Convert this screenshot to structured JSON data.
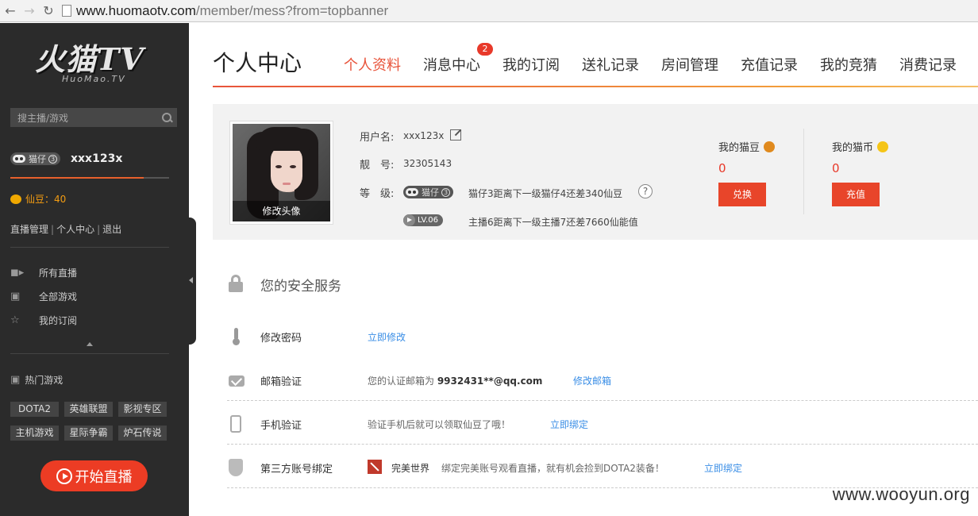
{
  "browser": {
    "url_host": "www.huomaotv.com",
    "url_path": "/member/mess?from=topbanner"
  },
  "sidebar": {
    "logo_main": "火猫TV",
    "logo_sub": "HuoMao.TV",
    "search_placeholder": "搜主播/游戏",
    "user": {
      "badge_label": "猫仔",
      "badge_level": "3",
      "name": "xxx123x",
      "level_progress": 0.84
    },
    "beans": "仙豆：40",
    "user_links": [
      "直播管理",
      "个人中心",
      "退出"
    ],
    "nav": [
      {
        "label": "所有直播",
        "icon": "video-camera-icon"
      },
      {
        "label": "全部游戏",
        "icon": "gamepad-icon"
      },
      {
        "label": "我的订阅",
        "icon": "star-icon"
      }
    ],
    "hot_title": "热门游戏",
    "hot_tags": [
      "DOTA2",
      "英雄联盟",
      "影视专区",
      "主机游戏",
      "星际争霸",
      "炉石传说"
    ],
    "live_button": "开始直播"
  },
  "header": {
    "title": "个人中心",
    "tabs": [
      "个人资料",
      "消息中心",
      "我的订阅",
      "送礼记录",
      "房间管理",
      "充值记录",
      "我的竞猜",
      "消费记录"
    ],
    "active_tab": 0,
    "message_count": "2"
  },
  "profile": {
    "avatar_caption": "修改头像",
    "username_label": "用户名:",
    "username": "xxx123x",
    "id_label": "靓　号:",
    "id": "32305143",
    "level_label": "等　级:",
    "fan_badge": "猫仔",
    "fan_badge_level": "3",
    "fan_level_desc": "猫仔3距离下一级猫仔4还差340仙豆",
    "help": "?",
    "anchor_badge": "LV.06",
    "anchor_level_desc": "主播6距离下一级主播7还差7660仙能值",
    "bean_label": "我的猫豆",
    "bean_value": "0",
    "bean_button": "兑换",
    "coin_label": "我的猫币",
    "coin_value": "0",
    "coin_button": "充值",
    "colors": {
      "accent": "#e8452a",
      "coin": "#f5c518",
      "bean": "#e08a1e"
    }
  },
  "security": {
    "title": "您的安全服务",
    "rows": [
      {
        "icon": "thermometer-icon",
        "name": "修改密码",
        "desc_prefix": "",
        "desc_bold": "",
        "link": "立即修改"
      },
      {
        "icon": "mail-icon",
        "name": "邮箱验证",
        "desc_prefix": "您的认证邮箱为 ",
        "desc_bold": "9932431**@qq.com",
        "link": "修改邮箱"
      },
      {
        "icon": "phone-icon",
        "name": "手机验证",
        "desc_prefix": "验证手机后就可以领取仙豆了哦！",
        "desc_bold": "",
        "link": "立即绑定"
      },
      {
        "icon": "shield-icon",
        "name": "第三方账号绑定",
        "partner": "完美世界",
        "desc_prefix": "绑定完美账号观看直播，就有机会捡到DOTA2装备！",
        "desc_bold": "",
        "link": "立即绑定"
      }
    ]
  },
  "watermark": "www.wooyun.org"
}
